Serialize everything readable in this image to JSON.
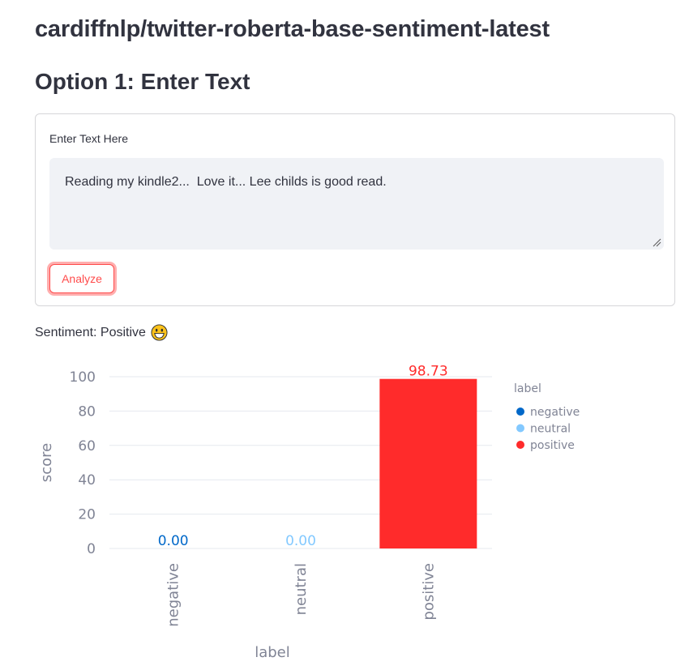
{
  "header": {
    "model_title": "cardiffnlp/twitter-roberta-base-sentiment-latest",
    "option_title": "Option 1: Enter Text"
  },
  "form": {
    "label": "Enter Text Here",
    "text_value": "Reading my kindle2...  Love it... Lee childs is good read.",
    "analyze_label": "Analyze"
  },
  "result": {
    "sentiment_text": "Sentiment: Positive",
    "emoji": "grinning-face-icon"
  },
  "colors": {
    "accent": "#ff4b4b",
    "negative": "#0068c9",
    "neutral": "#83c9ff",
    "positive": "#ff2b2b"
  },
  "chart_data": {
    "type": "bar",
    "categories": [
      "negative",
      "neutral",
      "positive"
    ],
    "values": [
      0.0,
      0.0,
      98.73
    ],
    "data_labels": [
      "0.00",
      "0.00",
      "98.73"
    ],
    "xlabel": "label",
    "ylabel": "score",
    "ylim": [
      0,
      100
    ],
    "yticks": [
      0,
      20,
      40,
      60,
      80,
      100
    ],
    "grid": true,
    "legend": {
      "title": "label",
      "entries": [
        "negative",
        "neutral",
        "positive"
      ],
      "placement": "right"
    }
  }
}
